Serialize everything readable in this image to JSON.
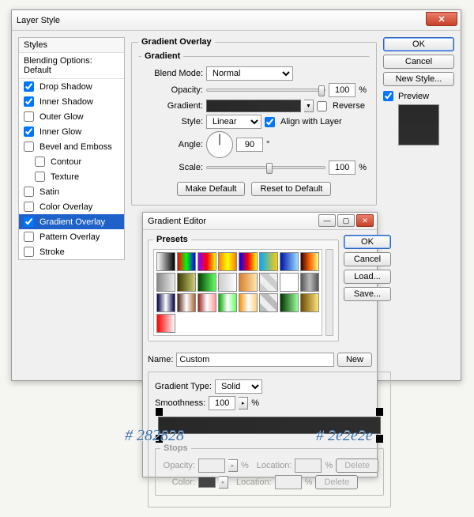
{
  "dialog": {
    "title": "Layer Style",
    "styles_header": "Styles",
    "blending": "Blending Options: Default",
    "items": [
      {
        "label": "Drop Shadow",
        "checked": true
      },
      {
        "label": "Inner Shadow",
        "checked": true
      },
      {
        "label": "Outer Glow",
        "checked": false
      },
      {
        "label": "Inner Glow",
        "checked": true
      },
      {
        "label": "Bevel and Emboss",
        "checked": false
      },
      {
        "label": "Contour",
        "checked": false,
        "indent": true
      },
      {
        "label": "Texture",
        "checked": false,
        "indent": true
      },
      {
        "label": "Satin",
        "checked": false
      },
      {
        "label": "Color Overlay",
        "checked": false
      },
      {
        "label": "Gradient Overlay",
        "checked": true,
        "selected": true
      },
      {
        "label": "Pattern Overlay",
        "checked": false
      },
      {
        "label": "Stroke",
        "checked": false
      }
    ],
    "section_title": "Gradient Overlay",
    "subsection_title": "Gradient",
    "blend": {
      "label": "Blend Mode:",
      "value": "Normal"
    },
    "opacity": {
      "label": "Opacity:",
      "value": "100",
      "suffix": "%"
    },
    "gradient_row": {
      "label": "Gradient:",
      "reverse": "Reverse"
    },
    "style_row": {
      "label": "Style:",
      "value": "Linear",
      "align": "Align with Layer"
    },
    "angle": {
      "label": "Angle:",
      "value": "90",
      "suffix": "°"
    },
    "scale": {
      "label": "Scale:",
      "value": "100",
      "suffix": "%"
    },
    "make_default": "Make Default",
    "reset_default": "Reset to Default",
    "ok": "OK",
    "cancel": "Cancel",
    "new_style": "New Style...",
    "preview": "Preview"
  },
  "editor": {
    "title": "Gradient Editor",
    "presets": "Presets",
    "ok": "OK",
    "cancel": "Cancel",
    "load": "Load...",
    "save": "Save...",
    "name_label": "Name:",
    "name_value": "Custom",
    "new": "New",
    "grad_type_label": "Gradient Type:",
    "grad_type_value": "Solid",
    "smoothness_label": "Smoothness:",
    "smoothness_value": "100",
    "smoothness_suffix": "%",
    "stops": "Stops",
    "opacity_label": "Opacity:",
    "color_label": "Color:",
    "location_label": "Location:",
    "percent": "%",
    "delete": "Delete"
  },
  "hex": {
    "left": "# 282828",
    "right": "# 2e2e2e"
  },
  "preset_colors": [
    "linear-gradient(90deg,#fff,#000)",
    "linear-gradient(90deg,#ff0000,#00ff00,#0000ff)",
    "linear-gradient(90deg,#8b00ff,#ff0000,#ffff00)",
    "linear-gradient(90deg,#ff7f00,#ffff00,#ff7f00)",
    "linear-gradient(90deg,#0000ff,#ff0000,#ffff00)",
    "linear-gradient(90deg,#00aaff,#ffcc00)",
    "linear-gradient(90deg,#0011aa,#99ddff)",
    "linear-gradient(90deg,#330000,#ff6600,#ffff88)",
    "linear-gradient(90deg,#888,#eee)",
    "linear-gradient(90deg,#3a3a00,#cece7a)",
    "linear-gradient(90deg,#004400,#66ff66)",
    "linear-gradient(90deg,#ccc,#fff)",
    "linear-gradient(90deg,#d87f2a,#ffe7b0)",
    "linear-gradient(45deg,#ccc 25%,#eee 25%,#eee 50%,#ccc 50%,#ccc 75%,#eee 75%)",
    "linear-gradient(90deg,#fff,#fff)",
    "linear-gradient(90deg,#555,#bbb,#555)",
    "linear-gradient(90deg,#004,#fff,#004)",
    "linear-gradient(90deg,#521,#fff,#a63)",
    "linear-gradient(90deg,#922,#fff,#f99)",
    "linear-gradient(90deg,#0a0,#fff,#6f6)",
    "linear-gradient(90deg,#ff8c00,#fff,#ffd27f)",
    "linear-gradient(45deg,#bbb 25%,#eee 25%,#eee 50%,#bbb 50%,#bbb 75%,#eee 75%)",
    "linear-gradient(90deg,#003300,#99ff99)",
    "linear-gradient(90deg,#6a4a00,#ffe680)",
    "linear-gradient(90deg,#ff0000,#fff)"
  ]
}
